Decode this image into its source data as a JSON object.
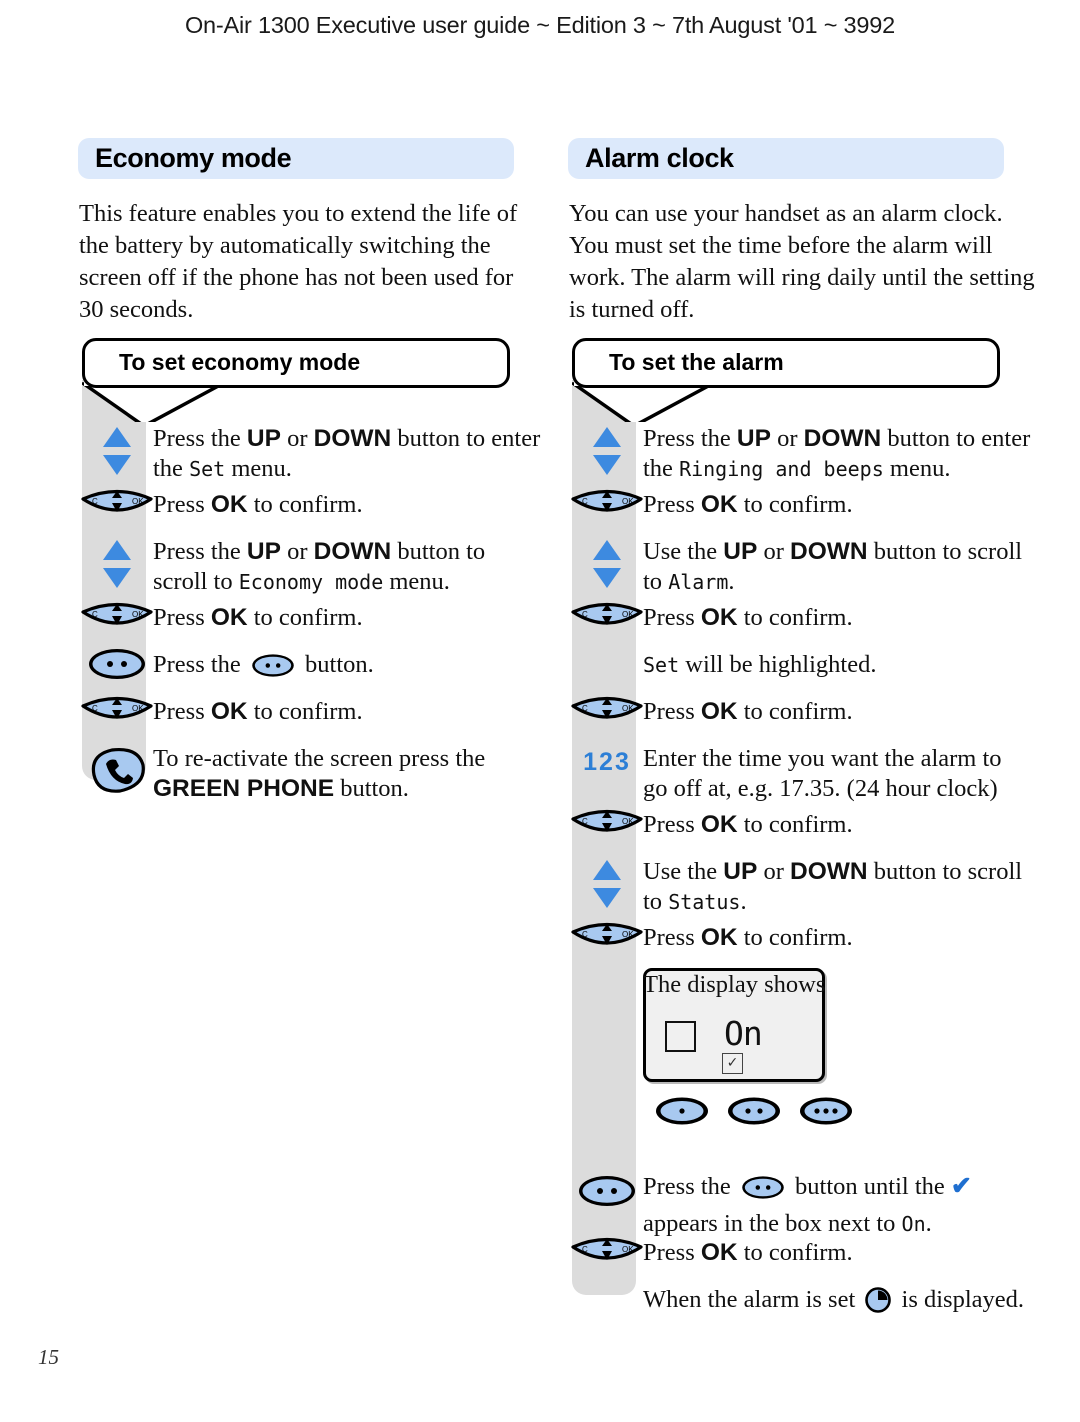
{
  "page": {
    "header": "On-Air 1300 Executive user guide ~ Edition 3 ~ 7th August '01 ~ 3992",
    "number": "15",
    "accent_blue": "#dce9fb",
    "icon_blue": "#a8c9f0",
    "band_grey": "#dcdcdc",
    "number_blue": "#2d7fd6"
  },
  "left": {
    "title": "Economy mode",
    "intro": [
      "This feature enables you to extend the life of",
      "the battery by automatically switching the",
      "screen off if the phone has not been used for",
      "30 seconds."
    ],
    "subheading": "To set economy mode",
    "steps": [
      {
        "icon": "up-down-arrows-icon",
        "lines": [
          [
            {
              "t": "Press the ",
              "s": "n"
            },
            {
              "t": "UP",
              "s": "b"
            },
            {
              "t": " or ",
              "s": "n"
            },
            {
              "t": "DOWN",
              "s": "b"
            },
            {
              "t": " button to enter",
              "s": "n"
            }
          ],
          [
            {
              "t": "the ",
              "s": "n"
            },
            {
              "t": "Set",
              "s": "lcd"
            },
            {
              "t": " menu.",
              "s": "n"
            }
          ]
        ]
      },
      {
        "icon": "navigation-key-icon",
        "lines": [
          [
            {
              "t": "Press ",
              "s": "n"
            },
            {
              "t": "OK",
              "s": "b"
            },
            {
              "t": " to confirm.",
              "s": "n"
            }
          ]
        ]
      },
      {
        "icon": "up-down-arrows-icon",
        "lines": [
          [
            {
              "t": "Press the ",
              "s": "n"
            },
            {
              "t": "UP",
              "s": "b"
            },
            {
              "t": " or ",
              "s": "n"
            },
            {
              "t": "DOWN",
              "s": "b"
            },
            {
              "t": " button to",
              "s": "n"
            }
          ],
          [
            {
              "t": "scroll to ",
              "s": "n"
            },
            {
              "t": "Economy mode",
              "s": "lcd"
            },
            {
              "t": " menu.",
              "s": "n"
            }
          ]
        ]
      },
      {
        "icon": "navigation-key-icon",
        "lines": [
          [
            {
              "t": "Press ",
              "s": "n"
            },
            {
              "t": "OK",
              "s": "b"
            },
            {
              "t": " to confirm.",
              "s": "n"
            }
          ]
        ]
      },
      {
        "icon": "two-dot-button-icon",
        "lines": [
          [
            {
              "t": "Press the ",
              "s": "n"
            },
            {
              "t": "",
              "s": "icon-twodot"
            },
            {
              "t": " button.",
              "s": "n"
            }
          ]
        ]
      },
      {
        "icon": "navigation-key-icon",
        "lines": [
          [
            {
              "t": "Press ",
              "s": "n"
            },
            {
              "t": "OK",
              "s": "b"
            },
            {
              "t": " to confirm.",
              "s": "n"
            }
          ]
        ]
      },
      {
        "icon": "green-phone-button-icon",
        "lines": [
          [
            {
              "t": "To re-activate the screen press the",
              "s": "n"
            }
          ],
          [
            {
              "t": "GREEN PHONE",
              "s": "b"
            },
            {
              "t": " button.",
              "s": "n"
            }
          ]
        ]
      }
    ]
  },
  "right": {
    "title": "Alarm clock",
    "intro": [
      "You can use your handset as an alarm clock.",
      "You must set the time before the alarm will",
      "work. The alarm will ring daily until the setting",
      "is turned off."
    ],
    "subheading": "To set the alarm",
    "steps": [
      {
        "icon": "up-down-arrows-icon",
        "lines": [
          [
            {
              "t": "Press the ",
              "s": "n"
            },
            {
              "t": "UP",
              "s": "b"
            },
            {
              "t": " or ",
              "s": "n"
            },
            {
              "t": "DOWN",
              "s": "b"
            },
            {
              "t": " button to enter",
              "s": "n"
            }
          ],
          [
            {
              "t": "the ",
              "s": "n"
            },
            {
              "t": "Ringing and beeps",
              "s": "lcd"
            },
            {
              "t": " menu.",
              "s": "n"
            }
          ]
        ]
      },
      {
        "icon": "navigation-key-icon",
        "lines": [
          [
            {
              "t": "Press ",
              "s": "n"
            },
            {
              "t": "OK",
              "s": "b"
            },
            {
              "t": " to confirm.",
              "s": "n"
            }
          ]
        ]
      },
      {
        "icon": "up-down-arrows-icon",
        "lines": [
          [
            {
              "t": "Use the ",
              "s": "n"
            },
            {
              "t": "UP",
              "s": "b"
            },
            {
              "t": " or ",
              "s": "n"
            },
            {
              "t": "DOWN",
              "s": "b"
            },
            {
              "t": " button to scroll",
              "s": "n"
            }
          ],
          [
            {
              "t": "to ",
              "s": "n"
            },
            {
              "t": "Alarm",
              "s": "lcd"
            },
            {
              "t": ".",
              "s": "n"
            }
          ]
        ]
      },
      {
        "icon": "navigation-key-icon",
        "lines": [
          [
            {
              "t": "Press ",
              "s": "n"
            },
            {
              "t": "OK",
              "s": "b"
            },
            {
              "t": " to confirm.",
              "s": "n"
            }
          ]
        ]
      },
      {
        "icon": "none",
        "lines": [
          [
            {
              "t": "Set",
              "s": "lcd"
            },
            {
              "t": " will be highlighted.",
              "s": "n"
            }
          ]
        ]
      },
      {
        "icon": "navigation-key-icon",
        "lines": [
          [
            {
              "t": "Press ",
              "s": "n"
            },
            {
              "t": "OK",
              "s": "b"
            },
            {
              "t": " to confirm.",
              "s": "n"
            }
          ]
        ]
      },
      {
        "icon": "number-keys-123-icon",
        "icon_label": "123",
        "lines": [
          [
            {
              "t": "Enter the time you want the alarm to",
              "s": "n"
            }
          ],
          [
            {
              "t": "go off at, e.g. 17.35. (24 hour clock)",
              "s": "n"
            }
          ]
        ]
      },
      {
        "icon": "navigation-key-icon",
        "lines": [
          [
            {
              "t": "Press ",
              "s": "n"
            },
            {
              "t": "OK",
              "s": "b"
            },
            {
              "t": " to confirm.",
              "s": "n"
            }
          ]
        ]
      },
      {
        "icon": "up-down-arrows-icon",
        "lines": [
          [
            {
              "t": "Use the ",
              "s": "n"
            },
            {
              "t": "UP",
              "s": "b"
            },
            {
              "t": " or ",
              "s": "n"
            },
            {
              "t": "DOWN",
              "s": "b"
            },
            {
              "t": " button to scroll",
              "s": "n"
            }
          ],
          [
            {
              "t": "to ",
              "s": "n"
            },
            {
              "t": "Status",
              "s": "lcd"
            },
            {
              "t": ".",
              "s": "n"
            }
          ]
        ]
      },
      {
        "icon": "navigation-key-icon",
        "lines": [
          [
            {
              "t": "Press ",
              "s": "n"
            },
            {
              "t": "OK",
              "s": "b"
            },
            {
              "t": " to confirm.",
              "s": "n"
            }
          ]
        ]
      },
      {
        "icon": "none",
        "lines": [
          [
            {
              "t": "The display shows",
              "s": "n"
            }
          ]
        ]
      }
    ],
    "display": {
      "empty_checkbox": "",
      "label": "On",
      "tick_box_glyph": "✓",
      "softkeys": [
        "one-dot-button",
        "two-dot-button",
        "three-dot-button"
      ]
    },
    "steps_after_display": [
      {
        "icon": "two-dot-button-icon",
        "lines": [
          [
            {
              "t": "Press the ",
              "s": "n"
            },
            {
              "t": "",
              "s": "icon-twodot"
            },
            {
              "t": " button until the ",
              "s": "n"
            },
            {
              "t": "✔",
              "s": "tick"
            }
          ],
          [
            {
              "t": "appears in the box next to ",
              "s": "n"
            },
            {
              "t": "On",
              "s": "lcd"
            },
            {
              "t": ".",
              "s": "n"
            }
          ]
        ]
      },
      {
        "icon": "navigation-key-icon",
        "lines": [
          [
            {
              "t": "Press ",
              "s": "n"
            },
            {
              "t": "OK",
              "s": "b"
            },
            {
              "t": " to confirm.",
              "s": "n"
            }
          ]
        ]
      },
      {
        "icon": "none",
        "lines": [
          [
            {
              "t": "When the alarm is set ",
              "s": "n"
            },
            {
              "t": "",
              "s": "icon-clock"
            },
            {
              "t": " is displayed.",
              "s": "n"
            }
          ]
        ]
      }
    ]
  }
}
